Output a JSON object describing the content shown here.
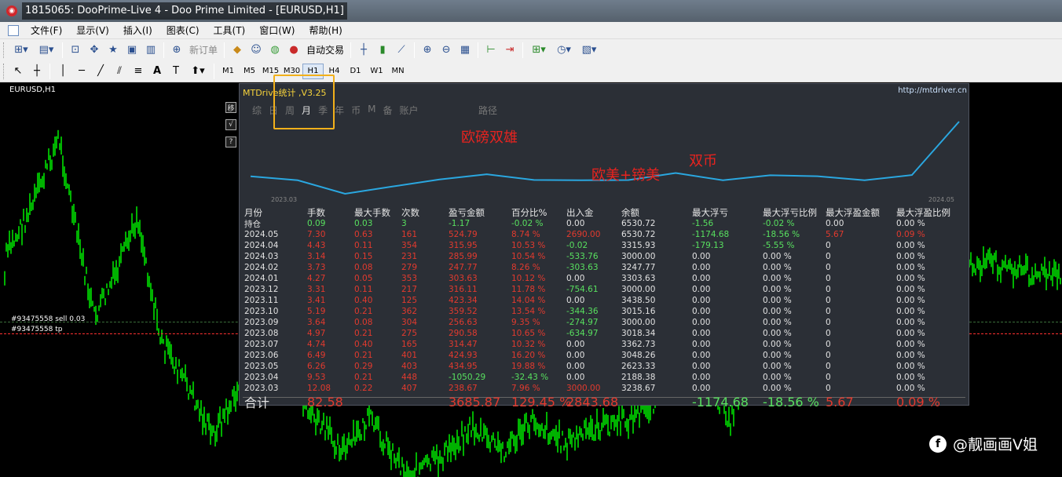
{
  "window": {
    "title": "1815065: DooPrime-Live 4 - Doo Prime Limited - [EURUSD,H1]"
  },
  "menu": [
    "文件(F)",
    "显示(V)",
    "插入(I)",
    "图表(C)",
    "工具(T)",
    "窗口(W)",
    "帮助(H)"
  ],
  "toolbar": {
    "new_order": "新订单",
    "auto_trading": "自动交易"
  },
  "timeframes": [
    "M1",
    "M5",
    "M15",
    "M30",
    "H1",
    "H4",
    "D1",
    "W1",
    "MN"
  ],
  "active_timeframe": "H1",
  "chart": {
    "symbol": "EURUSD,H1",
    "order_sell": "#93475558 sell 0.03",
    "order_tp": "#93475558 tp",
    "candle_color": "#00ff00",
    "sell_line_color": "#3a6f3a",
    "tp_line_color": "#ff3030"
  },
  "side_buttons": [
    "移",
    "√",
    "?"
  ],
  "panel": {
    "title": "MTDrive统计 ,V3.25",
    "url": "http://mtdriver.cn",
    "tabs": [
      "综",
      "日",
      "周",
      "月",
      "季",
      "年",
      "币",
      "M",
      "备",
      "账户"
    ],
    "active_tab": "月",
    "path_label": "路径",
    "graph": {
      "x_start": "2023.03",
      "x_end": "2024.05",
      "line_color": "#2aa7e0",
      "balance": [
        3238.67,
        3000.0,
        2188.38,
        2623.33,
        3048.26,
        3362.73,
        3018.34,
        3000.0,
        3015.16,
        3438.5,
        3000.0,
        3303.63,
        3247.77,
        3000.0,
        3315.93,
        6530.72
      ]
    },
    "annotations": [
      "欧磅双雄",
      "欧美+镑美",
      "双币"
    ],
    "columns": [
      "月份",
      "手数",
      "最大手数",
      "次数",
      "盈亏金额",
      "百分比%",
      "出入金",
      "余额",
      "最大浮亏",
      "最大浮亏比例",
      "最大浮盈金额",
      "最大浮盈比例"
    ],
    "holding": [
      "持仓",
      "0.09",
      "0.03",
      "3",
      "-1.17",
      "-0.02 %",
      "0.00",
      "6530.72",
      "-1.56",
      "-0.02 %",
      "0.00",
      "0.00 %"
    ],
    "rows": [
      [
        "2024.05",
        "7.30",
        "0.63",
        "161",
        "524.79",
        "8.74 %",
        "2690.00",
        "6530.72",
        "-1174.68",
        "-18.56 %",
        "5.67",
        "0.09 %"
      ],
      [
        "2024.04",
        "4.43",
        "0.11",
        "354",
        "315.95",
        "10.53 %",
        "-0.02",
        "3315.93",
        "-179.13",
        "-5.55 %",
        "0",
        "0.00 %"
      ],
      [
        "2024.03",
        "3.14",
        "0.15",
        "231",
        "285.99",
        "10.54 %",
        "-533.76",
        "3000.00",
        "0.00",
        "0.00 %",
        "0",
        "0.00 %"
      ],
      [
        "2024.02",
        "3.73",
        "0.08",
        "279",
        "247.77",
        "8.26 %",
        "-303.63",
        "3247.77",
        "0.00",
        "0.00 %",
        "0",
        "0.00 %"
      ],
      [
        "2024.01",
        "4.27",
        "0.05",
        "353",
        "303.63",
        "10.12 %",
        "0.00",
        "3303.63",
        "0.00",
        "0.00 %",
        "0",
        "0.00 %"
      ],
      [
        "2023.12",
        "3.31",
        "0.11",
        "217",
        "316.11",
        "11.78 %",
        "-754.61",
        "3000.00",
        "0.00",
        "0.00 %",
        "0",
        "0.00 %"
      ],
      [
        "2023.11",
        "3.41",
        "0.40",
        "125",
        "423.34",
        "14.04 %",
        "0.00",
        "3438.50",
        "0.00",
        "0.00 %",
        "0",
        "0.00 %"
      ],
      [
        "2023.10",
        "5.19",
        "0.21",
        "362",
        "359.52",
        "13.54 %",
        "-344.36",
        "3015.16",
        "0.00",
        "0.00 %",
        "0",
        "0.00 %"
      ],
      [
        "2023.09",
        "3.64",
        "0.08",
        "304",
        "256.63",
        "9.35 %",
        "-274.97",
        "3000.00",
        "0.00",
        "0.00 %",
        "0",
        "0.00 %"
      ],
      [
        "2023.08",
        "4.97",
        "0.21",
        "275",
        "290.58",
        "10.65 %",
        "-634.97",
        "3018.34",
        "0.00",
        "0.00 %",
        "0",
        "0.00 %"
      ],
      [
        "2023.07",
        "4.74",
        "0.40",
        "165",
        "314.47",
        "10.32 %",
        "0.00",
        "3362.73",
        "0.00",
        "0.00 %",
        "0",
        "0.00 %"
      ],
      [
        "2023.06",
        "6.49",
        "0.21",
        "401",
        "424.93",
        "16.20 %",
        "0.00",
        "3048.26",
        "0.00",
        "0.00 %",
        "0",
        "0.00 %"
      ],
      [
        "2023.05",
        "6.26",
        "0.29",
        "403",
        "434.95",
        "19.88 %",
        "0.00",
        "2623.33",
        "0.00",
        "0.00 %",
        "0",
        "0.00 %"
      ],
      [
        "2023.04",
        "9.53",
        "0.21",
        "448",
        "-1050.29",
        "-32.43 %",
        "0.00",
        "2188.38",
        "0.00",
        "0.00 %",
        "0",
        "0.00 %"
      ],
      [
        "2023.03",
        "12.08",
        "0.22",
        "407",
        "238.67",
        "7.96 %",
        "3000.00",
        "3238.67",
        "0.00",
        "0.00 %",
        "0",
        "0.00 %"
      ]
    ],
    "total": [
      "合计",
      "82.58",
      "",
      "",
      "3685.87",
      "129.45 %",
      "2843.68",
      "",
      "-1174.68",
      "-18.56 %",
      "5.67",
      "0.09 %"
    ],
    "colors": {
      "positive": "#e23a2e",
      "negative": "#58e05f",
      "neutral": "#e2e2e2",
      "highlight": "#f2b01b"
    }
  },
  "watermark": "@靓画画V姐"
}
